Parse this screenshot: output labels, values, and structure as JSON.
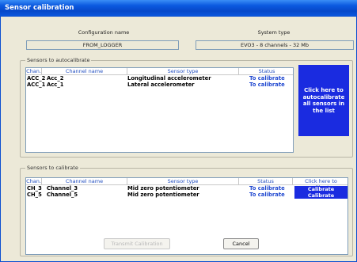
{
  "window": {
    "title": "Sensor calibration"
  },
  "config": {
    "config_label": "Configuration name",
    "config_value": "FROM_LOGGER",
    "system_label": "System type",
    "system_value": "EVO3 - 8 channels - 32 Mb"
  },
  "auto": {
    "legend": "Sensors to autocalibrate",
    "headers": [
      "Chan.",
      "Channel name",
      "Sensor type",
      "Status"
    ],
    "rows": [
      {
        "chan": "ACC_2",
        "name": "Acc_2",
        "type": "Longitudinal accelerometer",
        "status": "To calibrate"
      },
      {
        "chan": "ACC_1",
        "name": "Acc_1",
        "type": "Lateral accelerometer",
        "status": "To calibrate"
      }
    ],
    "button": "Click here to autocalibrate all sensors  in the list"
  },
  "cal": {
    "legend": "Sensors to calibrate",
    "headers": [
      "Chan.",
      "Channel name",
      "Sensor type",
      "Status",
      "Click here to calibrate"
    ],
    "rows": [
      {
        "chan": "CH_3",
        "name": "Channel_3",
        "type": "Mid zero potentiometer",
        "status": "To calibrate",
        "action": "Calibrate"
      },
      {
        "chan": "CH_5",
        "name": "Channel_5",
        "type": "Mid zero potentiometer",
        "status": "To calibrate",
        "action": "Calibrate"
      }
    ]
  },
  "buttons": {
    "transmit": "Transmit Calibration",
    "cancel": "Cancel"
  },
  "colors": {
    "title_bar": "#0b59e0",
    "action_blue": "#1a2be0",
    "status_text": "#2048d0"
  }
}
